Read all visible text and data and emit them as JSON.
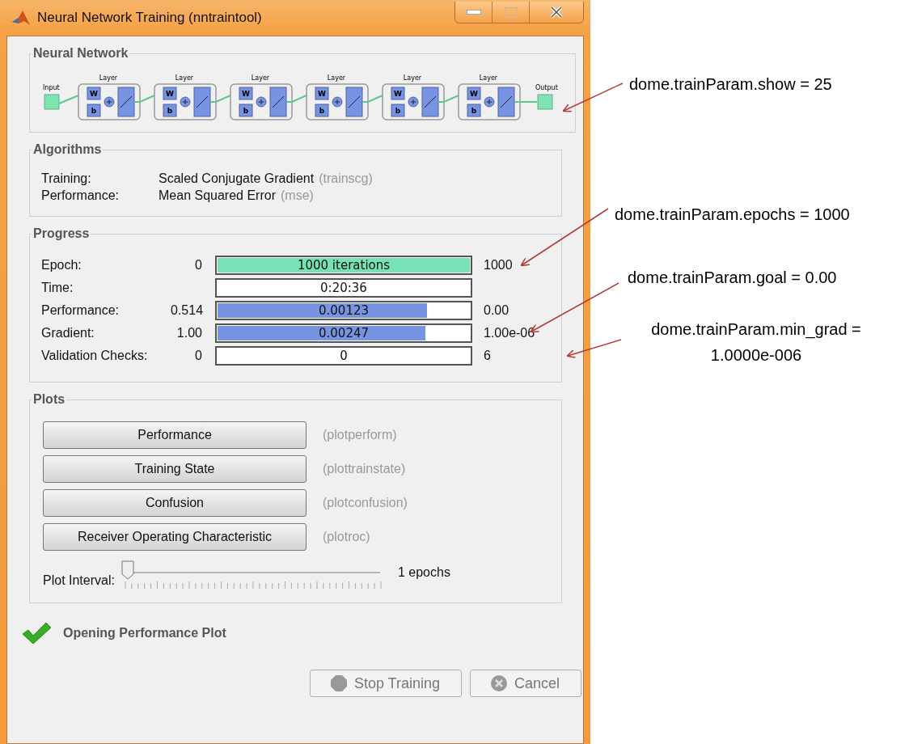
{
  "window": {
    "title": "Neural Network Training (nntraintool)"
  },
  "network": {
    "title": "Neural Network",
    "input": "Input",
    "output": "Output",
    "layers": [
      {
        "label": "Layer",
        "weight": "W",
        "bias": "b"
      },
      {
        "label": "Layer",
        "weight": "W",
        "bias": "b"
      },
      {
        "label": "Layer",
        "weight": "W",
        "bias": "b"
      },
      {
        "label": "Layer",
        "weight": "W",
        "bias": "b"
      },
      {
        "label": "Layer",
        "weight": "W",
        "bias": "b"
      },
      {
        "label": "Layer",
        "weight": "W",
        "bias": "b"
      }
    ]
  },
  "algorithms": {
    "title": "Algorithms",
    "rows": [
      {
        "label": "Training:",
        "value": "Scaled Conjugate Gradient",
        "code": "(trainscg)"
      },
      {
        "label": "Performance:",
        "value": "Mean Squared Error",
        "code": "(mse)"
      }
    ]
  },
  "progress": {
    "title": "Progress",
    "rows": [
      {
        "label": "Epoch:",
        "start": "0",
        "text": "1000 iterations",
        "level": 1,
        "color": "#77e3b4",
        "end": "1000"
      },
      {
        "label": "Time:",
        "text": "0:20:36"
      },
      {
        "label": "Performance:",
        "start": "0.514",
        "text": "0.00123",
        "level": 0.83,
        "color": "#7794e3",
        "end": "0.00"
      },
      {
        "label": "Gradient:",
        "start": "1.00",
        "text": "0.00247",
        "level": 0.825,
        "color": "#7794e3",
        "end": "1.00e-06"
      },
      {
        "label": "Validation Checks:",
        "start": "0",
        "text": "0",
        "end": "6"
      }
    ]
  },
  "plots": {
    "title": "Plots",
    "buttons": [
      {
        "label": "Performance",
        "code": "(plotperform)"
      },
      {
        "label": "Training State",
        "code": "(plottrainstate)"
      },
      {
        "label": "Confusion",
        "code": "(plotconfusion)"
      },
      {
        "label": "Receiver Operating Characteristic",
        "code": "(plotroc)"
      }
    ],
    "interval": {
      "label": "Plot Interval:",
      "level": 0,
      "reading": "1 epochs"
    }
  },
  "status": "Opening Performance Plot",
  "buttons": [
    {
      "label": "Stop Training",
      "kind": "stop",
      "disabled": true
    },
    {
      "label": "Cancel",
      "kind": "cancel",
      "disabled": true
    }
  ],
  "annotations": [
    {
      "text": "dome.trainParam.show  =  25"
    },
    {
      "text": "dome.trainParam.epochs  = 1000"
    },
    {
      "text": "dome.trainParam.goal  = 0.00"
    },
    {
      "text": "dome.trainParam.min_grad = 1.0000e-006"
    }
  ]
}
